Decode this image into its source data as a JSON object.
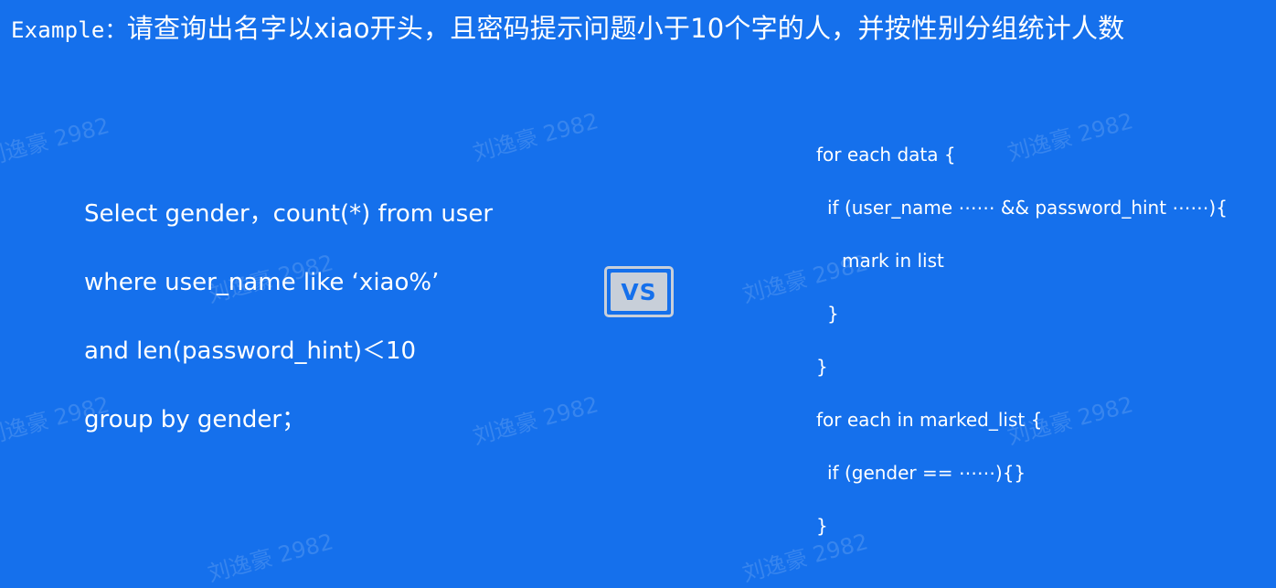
{
  "headline": {
    "label": "Example：",
    "question": "请查询出名字以xiao开头，且密码提示问题小于10个字的人，并按性别分组统计人数"
  },
  "sql": {
    "lines": [
      "Select gender，count(*) from user",
      "where user_name like ‘xiao%’",
      "and len(password_hint)＜10",
      "group by gender；"
    ]
  },
  "vs": {
    "label": "VS"
  },
  "loop": {
    "lines": [
      "for each data {",
      "if (user_name ⋯⋯ && password_hint ⋯⋯){",
      "mark in list",
      "}",
      "}",
      "for each in marked_list {",
      "if (gender == ⋯⋯){}",
      "}"
    ]
  },
  "watermark": {
    "text": "刘逸豪 2982"
  }
}
